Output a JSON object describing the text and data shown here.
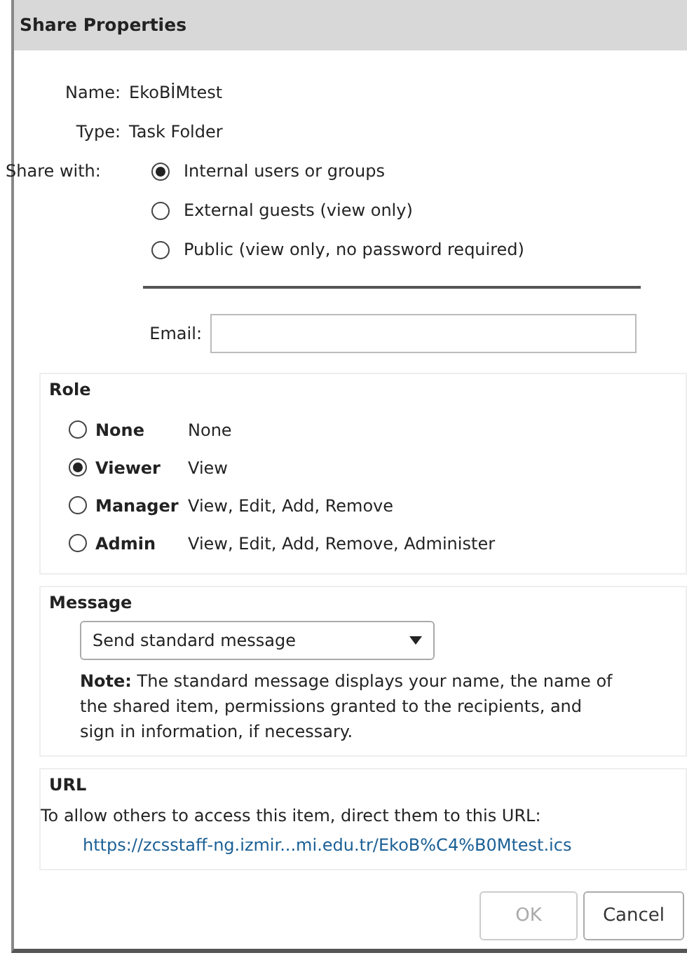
{
  "window": {
    "title": "Share Properties"
  },
  "fields": [
    {
      "label": "Name:",
      "value": "EkoBİMtest"
    },
    {
      "label": "Type:",
      "value": "Task Folder"
    }
  ],
  "share_with": {
    "label": "Share with:",
    "options": [
      {
        "label": "Internal users or groups",
        "selected": true
      },
      {
        "label": "External guests (view only)",
        "selected": false
      },
      {
        "label": "Public (view only, no password required)",
        "selected": false
      }
    ]
  },
  "email": {
    "label": "Email:"
  },
  "role": {
    "title": "Role",
    "options": [
      {
        "name": "None",
        "rights": "None",
        "selected": false
      },
      {
        "name": "Viewer",
        "rights": "View",
        "selected": true
      },
      {
        "name": "Manager",
        "rights": "View, Edit, Add, Remove",
        "selected": false
      },
      {
        "name": "Admin",
        "rights": "View, Edit, Add, Remove, Administer",
        "selected": false
      }
    ]
  },
  "message": {
    "title": "Message",
    "dropdown": "Send standard message",
    "note": "**Note:** The standard message displays your name, the name of the shared item, permissions granted to the recipients, and sign in information, if necessary."
  },
  "url": {
    "title": "URL",
    "text": "To allow others to access this item, direct them to this URL:",
    "link": "https://zcsstaff-ng.izmir...mi.edu.tr/EkoB%C4%B0Mtest.ics"
  },
  "buttons": [
    {
      "label": "OK",
      "disabled": true
    },
    {
      "label": "Cancel",
      "disabled": false
    }
  ]
}
